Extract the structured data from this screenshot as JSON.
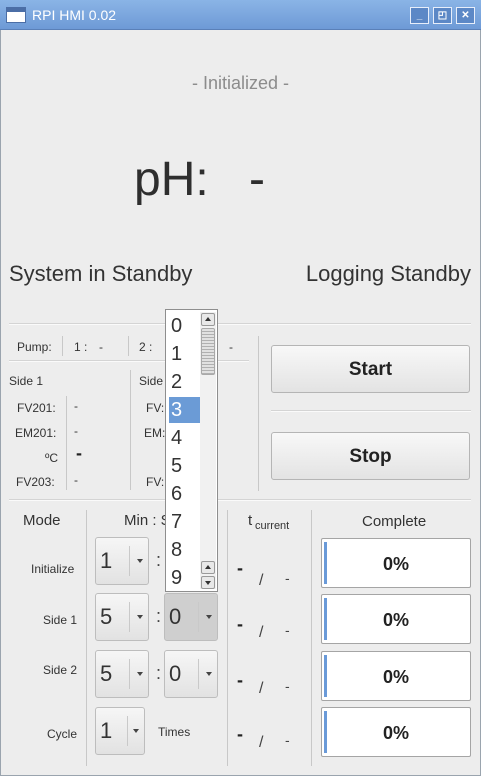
{
  "window": {
    "title": "RPI HMI 0.02",
    "minimize": "_",
    "maximize": "◰",
    "close": "✕"
  },
  "status": {
    "state": "- Initialized -",
    "ph_label": "pH:",
    "ph_value": "-",
    "system": "System in Standby",
    "logging": "Logging Standby"
  },
  "pumps": {
    "label": "Pump:",
    "p1_label": "1 :",
    "p1_value": "-",
    "p2_label": "2 :",
    "p2_value": "-"
  },
  "side1": {
    "title": "Side 1",
    "fv201_label": "FV201:",
    "fv201_value": "-",
    "em201_label": "EM201:",
    "em201_value": "-",
    "temp_label": "ºC",
    "temp_value": "-",
    "fv203_label": "FV203:",
    "fv203_value": "-"
  },
  "side2": {
    "title": "Side",
    "fv_label": "FV:",
    "em_label": "EM:",
    "fv2_label": "FV:"
  },
  "buttons": {
    "start": "Start",
    "stop": "Stop"
  },
  "table": {
    "mode_header": "Mode",
    "minsec_header": "Min : S",
    "tcurrent_header": "t",
    "tcurrent_sub": "current",
    "complete_header": "Complete",
    "times_label": "Times",
    "rows": [
      {
        "mode": "Initialize",
        "min": "1",
        "sec": "",
        "t_now": "-",
        "t_slash": "/",
        "t_total": "-",
        "complete": "0%"
      },
      {
        "mode": "Side 1",
        "min": "5",
        "sec": "0",
        "t_now": "-",
        "t_slash": "/",
        "t_total": "-",
        "complete": "0%"
      },
      {
        "mode": "Side 2",
        "min": "5",
        "sec": "0",
        "t_now": "-",
        "t_slash": "/",
        "t_total": "-",
        "complete": "0%"
      },
      {
        "mode": "Cycle",
        "min": "1",
        "sec": "",
        "t_now": "-",
        "t_slash": "/",
        "t_total": "-",
        "complete": "0%"
      }
    ],
    "colon": ":"
  },
  "dropdown": {
    "options": [
      "0",
      "1",
      "2",
      "3",
      "4",
      "5",
      "6",
      "7",
      "8",
      "9"
    ],
    "selected_index": 3
  },
  "colors": {
    "titlebar": "#7aa6de",
    "selection": "#6b9bd6",
    "progress_fill": "#6a9ad8"
  },
  "progress_fraction": [
    0,
    0,
    0,
    0
  ]
}
